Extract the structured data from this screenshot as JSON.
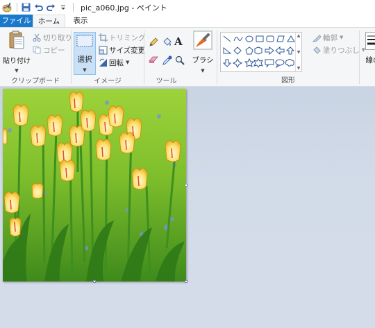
{
  "title": "pic_a060.jpg - ペイント",
  "tabs": {
    "file": "ファイル",
    "home": "ホーム",
    "view": "表示"
  },
  "clipboard": {
    "paste": "貼り付け",
    "cut": "切り取り",
    "copy": "コピー",
    "label": "クリップボード"
  },
  "image": {
    "select": "選択",
    "crop": "トリミング",
    "resize": "サイズ変更",
    "rotate": "回転",
    "label": "イメージ"
  },
  "tools": {
    "label": "ツール",
    "text_glyph": "A"
  },
  "brushes": {
    "label": "ブラシ"
  },
  "shapes": {
    "label": "図形",
    "outline": "輪郭",
    "fill": "塗りつぶし"
  },
  "colors": {
    "line_width": "線の"
  },
  "accent": {
    "file_tab": "#1979ca",
    "select_bg": "#c9e0f7"
  },
  "canvas": {
    "image_subject": "tulips"
  }
}
